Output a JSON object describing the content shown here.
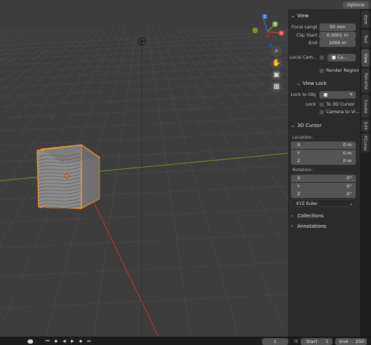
{
  "header": {
    "options_label": "Options"
  },
  "view_panel": {
    "title": "View",
    "focal_length_label": "Focal Lengt",
    "focal_length_value": "50 mm",
    "clip_start_label": "Clip Start",
    "clip_start_value": "0.0001 m",
    "clip_end_label": "End",
    "clip_end_value": "1000 m",
    "local_camera_label": "Local Cam...",
    "local_camera_value": "Ca...",
    "render_region_label": "Render Region"
  },
  "view_lock": {
    "title": "View Lock",
    "lock_to_obj_label": "Lock to Obj",
    "lock_label": "Lock",
    "to_3d_cursor_label": "To 3D Cursor",
    "camera_to_view_label": "Camera to Vi..."
  },
  "cursor_panel": {
    "title": "3D Cursor",
    "location_label": "Location:",
    "location": [
      {
        "axis": "X",
        "value": "0 m"
      },
      {
        "axis": "Y",
        "value": "0 m"
      },
      {
        "axis": "Z",
        "value": "0 m"
      }
    ],
    "rotation_label": "Rotation:",
    "rotation": [
      {
        "axis": "X",
        "value": "0°"
      },
      {
        "axis": "Y",
        "value": "0°"
      },
      {
        "axis": "Z",
        "value": "0°"
      }
    ],
    "rotation_mode": "XYZ Euler"
  },
  "collapsed_sections": [
    {
      "label": "Collections"
    },
    {
      "label": "Annotations"
    }
  ],
  "side_tabs": [
    "Item",
    "Tool",
    "View",
    "Rename",
    "Create",
    "Edit",
    "PCurve"
  ],
  "active_tab": "View",
  "gizmo": {
    "x_label": "X",
    "y_label": "Y",
    "z_label": "Z"
  },
  "timeline": {
    "current_frame": "1",
    "start_label": "Start",
    "start_value": "1",
    "end_label": "End",
    "end_value": "250"
  },
  "colors": {
    "viewport_bg": "#3d3d3d",
    "x_axis": "#c03a3a",
    "y_axis": "#6e9a2c",
    "selection": "#f09a2a",
    "panel_bg": "#2b2b2b",
    "field_bg": "#545454"
  }
}
